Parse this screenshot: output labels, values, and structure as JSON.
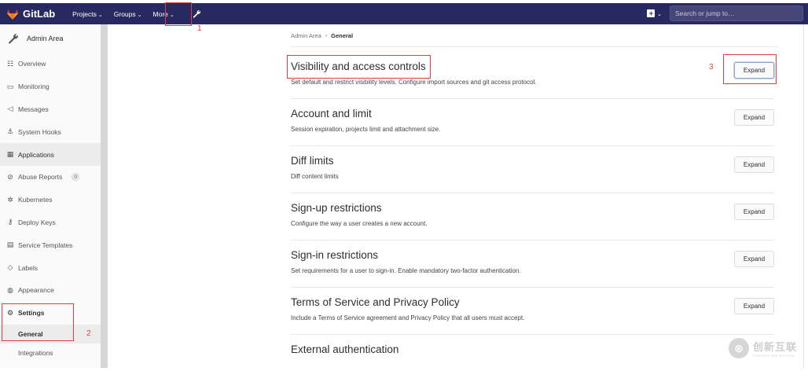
{
  "navbar": {
    "brand": "GitLab",
    "items": [
      {
        "label": "Projects",
        "chevron": "⌄"
      },
      {
        "label": "Groups",
        "chevron": "⌄"
      },
      {
        "label": "More",
        "chevron": "⌄"
      }
    ],
    "admin_icon": "wrench-icon",
    "new_icon": "plus-square-icon",
    "search_placeholder": "Search or jump to…",
    "background": "#292961"
  },
  "sidebar": {
    "title": "Admin Area",
    "items": [
      {
        "label": "Overview",
        "icon": "overview-icon"
      },
      {
        "label": "Monitoring",
        "icon": "monitor-icon"
      },
      {
        "label": "Messages",
        "icon": "bullhorn-icon"
      },
      {
        "label": "System Hooks",
        "icon": "hook-icon"
      },
      {
        "label": "Applications",
        "icon": "applications-icon"
      },
      {
        "label": "Abuse Reports",
        "icon": "abuse-icon",
        "badge": "0"
      },
      {
        "label": "Kubernetes",
        "icon": "kubernetes-icon"
      },
      {
        "label": "Deploy Keys",
        "icon": "key-icon"
      },
      {
        "label": "Service Templates",
        "icon": "template-icon"
      },
      {
        "label": "Labels",
        "icon": "label-icon"
      },
      {
        "label": "Appearance",
        "icon": "appearance-icon"
      }
    ],
    "settings": {
      "label": "Settings",
      "icon": "gear-icon"
    },
    "sub_items": [
      {
        "label": "General"
      },
      {
        "label": "Integrations"
      }
    ]
  },
  "breadcrumb": {
    "parent": "Admin Area",
    "separator": "›",
    "current": "General"
  },
  "sections": [
    {
      "title": "Visibility and access controls",
      "description": "Set default and restrict visibility levels. Configure import sources and git access protocol.",
      "button": "Expand"
    },
    {
      "title": "Account and limit",
      "description": "Session expiration, projects limit and attachment size.",
      "button": "Expand"
    },
    {
      "title": "Diff limits",
      "description": "Diff content limits",
      "button": "Expand"
    },
    {
      "title": "Sign-up restrictions",
      "description": "Configure the way a user creates a new account.",
      "button": "Expand"
    },
    {
      "title": "Sign-in restrictions",
      "description": "Set requirements for a user to sign-in. Enable mandatory two-factor authentication.",
      "button": "Expand"
    },
    {
      "title": "Terms of Service and Privacy Policy",
      "description": "Include a Terms of Service agreement and Privacy Policy that all users must accept.",
      "button": "Expand"
    },
    {
      "title": "External authentication",
      "description": "",
      "button": ""
    }
  ],
  "annotations": {
    "n1": "1",
    "n2": "2",
    "n3": "3",
    "color": "#e03e3e"
  },
  "watermark": {
    "glyph": "⊗",
    "cn": "创新互联",
    "en": "CHUANG XIN HU LIAN"
  }
}
